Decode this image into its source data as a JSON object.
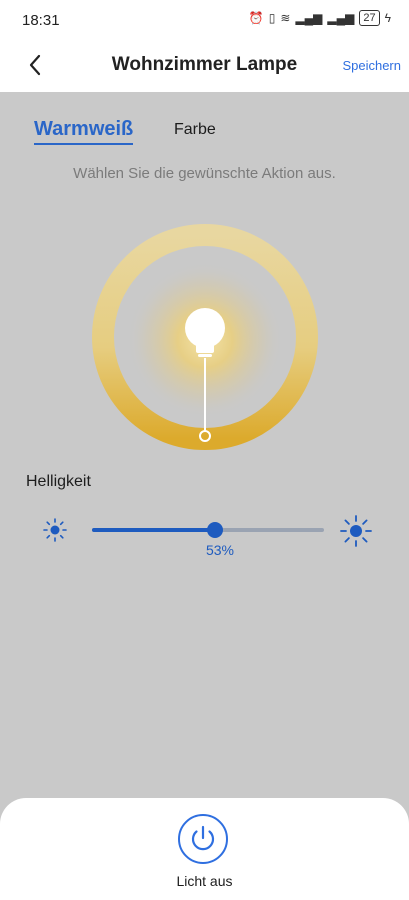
{
  "status_bar": {
    "time": "18:31",
    "battery": "27",
    "icons": [
      "alarm-icon",
      "vibrate-icon",
      "wifi-icon",
      "signal-icon",
      "signal-icon",
      "charging-icon"
    ]
  },
  "header": {
    "title": "Wohnzimmer Lampe",
    "save_label": "Speichern"
  },
  "tabs": [
    {
      "label": "Warmweiß",
      "active": true
    },
    {
      "label": "Farbe",
      "active": false
    }
  ],
  "hint": "Wählen Sie die gewünschte Aktion aus.",
  "brightness": {
    "label": "Helligkeit",
    "value_percent": 53,
    "value_text": "53%"
  },
  "power": {
    "label": "Licht aus"
  },
  "colors": {
    "accent": "#2f6fe0",
    "ring_warm": "#e2b93a",
    "ring_light": "#e9d69f",
    "background": "#c9c9c9"
  }
}
